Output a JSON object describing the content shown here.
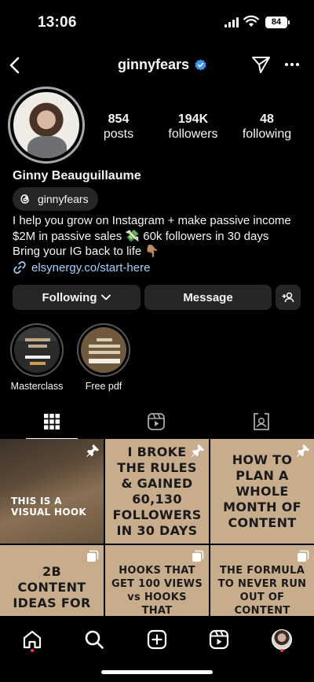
{
  "status": {
    "time": "13:06",
    "battery": "84"
  },
  "header": {
    "username": "ginnyfears"
  },
  "profile": {
    "stats": [
      {
        "num": "854",
        "label": "posts"
      },
      {
        "num": "194K",
        "label": "followers"
      },
      {
        "num": "48",
        "label": "following"
      }
    ],
    "full_name": "Ginny Beauguillaume",
    "threads_handle": "ginnyfears",
    "bio": [
      "I help you grow on Instagram + make passive income",
      "$2M in passive sales 💸 60k followers in 30 days",
      "Bring your IG back to life 👇🏽"
    ],
    "link": "elsynergy.co/start-here"
  },
  "actions": {
    "following": "Following",
    "message": "Message"
  },
  "highlights": [
    {
      "label": "Masterclass"
    },
    {
      "label": "Free pdf"
    }
  ],
  "posts": [
    {
      "text": "THIS IS A VISUAL HOOK",
      "pinned": true
    },
    {
      "text": "I BROKE THE RULES & GAINED 60,130 FOLLOWERS IN 30 DAYS",
      "pinned": true
    },
    {
      "text": "HOW TO PLAN A WHOLE MONTH OF CONTENT",
      "pinned": true
    },
    {
      "text": "2B CONTENT IDEAS FOR",
      "pinned": false
    },
    {
      "text": "HOOKS THAT GET 100 VIEWS vs HOOKS THAT",
      "pinned": false
    },
    {
      "text": "THE FORMULA TO NEVER RUN OUT OF CONTENT IDEAS",
      "pinned": false
    }
  ],
  "colors": {
    "background": "#000000",
    "button": "#262626",
    "link": "#9fd2ff",
    "verified": "#3897f0",
    "notification": "#ff3040"
  }
}
